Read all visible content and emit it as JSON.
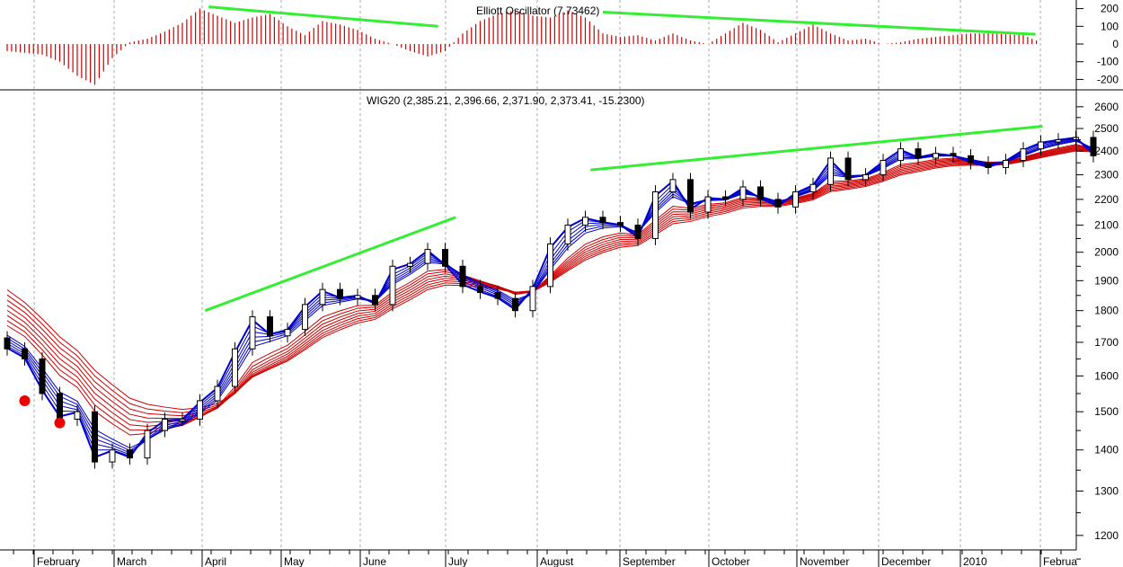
{
  "chart_data": [
    {
      "type": "bar",
      "title": "Elliott Oscillator (7.73462)",
      "yticks": [
        200,
        100,
        0,
        -100,
        -200
      ],
      "ylim": [
        -250,
        250
      ],
      "bar_color": "#cc0000",
      "values": [
        -40,
        -50,
        -60,
        -100,
        -180,
        -230,
        -80,
        10,
        30,
        70,
        120,
        200,
        160,
        120,
        150,
        170,
        100,
        50,
        130,
        110,
        80,
        30,
        0,
        -40,
        -70,
        -40,
        60,
        130,
        170,
        190,
        160,
        150,
        190,
        150,
        60,
        40,
        50,
        20,
        60,
        20,
        0,
        60,
        120,
        80,
        10,
        60,
        110,
        60,
        20,
        30,
        0,
        10,
        30,
        40,
        50,
        60,
        60,
        55,
        50,
        10
      ],
      "trendlines": [
        {
          "color": "#33ee33",
          "from": [
            11.5,
            210
          ],
          "to": [
            24.6,
            100
          ]
        },
        {
          "color": "#33ee33",
          "from": [
            34,
            180
          ],
          "to": [
            58.7,
            55
          ]
        }
      ]
    },
    {
      "type": "candlestick",
      "title": "WIG20 (2,385.21, 2,396.66, 2,371.90, 2,373.41, -15.2300)",
      "yscale": "log",
      "yticks": [
        2600,
        2500,
        2400,
        2300,
        2200,
        2100,
        2000,
        1900,
        1800,
        1700,
        1600,
        1500,
        1400,
        1300,
        1200
      ],
      "ylim": [
        1180,
        2680
      ],
      "closes": [
        1680,
        1650,
        1550,
        1480,
        1500,
        1370,
        1400,
        1380,
        1450,
        1480,
        1480,
        1530,
        1570,
        1680,
        1780,
        1720,
        1740,
        1820,
        1870,
        1840,
        1850,
        1820,
        1950,
        1960,
        2010,
        1950,
        1880,
        1860,
        1840,
        1800,
        1880,
        2030,
        2100,
        2130,
        2110,
        2100,
        2050,
        2230,
        2280,
        2150,
        2210,
        2200,
        2250,
        2200,
        2170,
        2230,
        2260,
        2370,
        2280,
        2300,
        2360,
        2410,
        2370,
        2390,
        2380,
        2350,
        2330,
        2360,
        2410,
        2440,
        2450,
        2460,
        2380
      ],
      "ribbon_short_color": "#0000cc",
      "ribbon_long_color": "#cc0000",
      "markers": [
        {
          "index": 1,
          "value": 1530,
          "color": "#ee0000"
        },
        {
          "index": 3,
          "value": 1470,
          "color": "#ee0000"
        }
      ],
      "trendlines": [
        {
          "color": "#33ee33",
          "from": [
            11.3,
            1800
          ],
          "to": [
            25.6,
            2130
          ]
        },
        {
          "color": "#33ee33",
          "from": [
            33.3,
            2320
          ],
          "to": [
            59.1,
            2510
          ]
        }
      ]
    }
  ],
  "xaxis": {
    "months": [
      "February",
      "March",
      "April",
      "May",
      "June",
      "July",
      "August",
      "September",
      "October",
      "November",
      "December",
      "2010",
      "Februa"
    ]
  }
}
